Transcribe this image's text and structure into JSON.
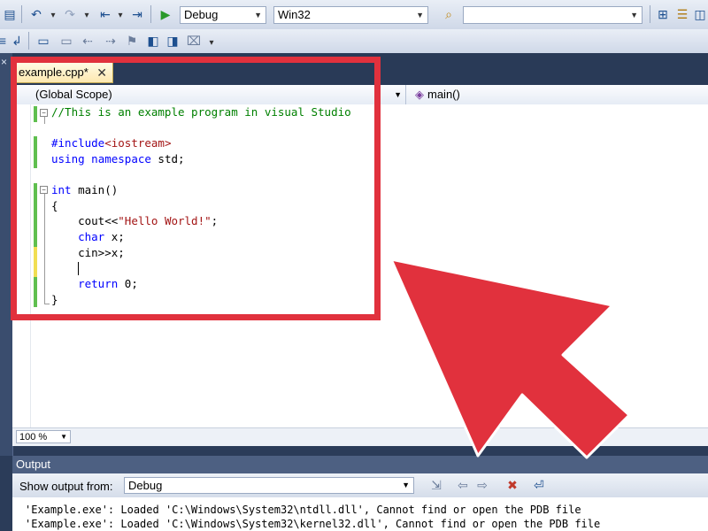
{
  "toolbar": {
    "config": "Debug",
    "platform": "Win32",
    "find_value": ""
  },
  "editor": {
    "tab_label": "example.cpp*",
    "scope": "(Global Scope)",
    "member": "main()",
    "zoom": "100 %",
    "lines": {
      "l1_comment": "//This is an example program in visual Studio",
      "l3_dir": "#include",
      "l3_hdr": "<iostream>",
      "l4_using": "using",
      "l4_ns": "namespace",
      "l4_std": " std;",
      "l6_kw": "int",
      "l6_rest": " main()",
      "l7": "{",
      "l8_a": "    cout<<",
      "l8_str": "\"Hello World!\"",
      "l8_end": ";",
      "l9_kw": "char",
      "l9_rest": " x;",
      "l10": "    cin>>x;",
      "l12_kw": "return",
      "l12_rest": " 0;",
      "l13": "}"
    }
  },
  "output": {
    "title": "Output",
    "show_label": "Show output from:",
    "source": "Debug",
    "lines": [
      "'Example.exe': Loaded 'C:\\Windows\\System32\\ntdll.dll', Cannot find or open the PDB file",
      "'Example.exe': Loaded 'C:\\Windows\\System32\\kernel32.dll', Cannot find or open the PDB file"
    ]
  },
  "colors": {
    "annotation_red": "#e1313d",
    "comment_green": "#008000",
    "keyword_blue": "#0000ff",
    "string_red": "#a31515"
  }
}
